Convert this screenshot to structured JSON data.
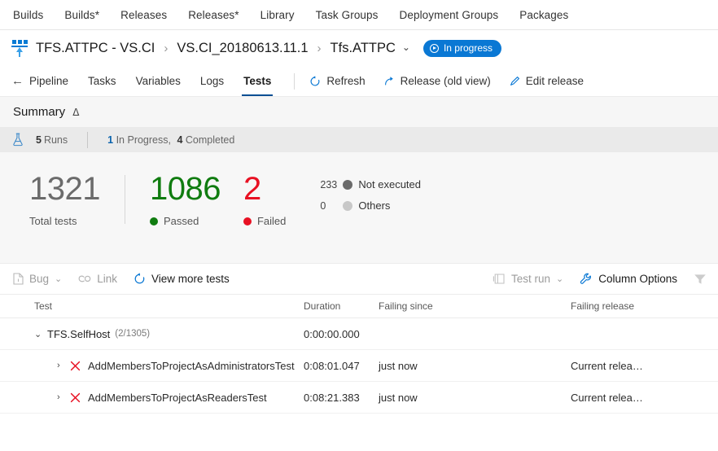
{
  "topnav": {
    "items": [
      {
        "label": "Builds"
      },
      {
        "label": "Builds*"
      },
      {
        "label": "Releases"
      },
      {
        "label": "Releases*"
      },
      {
        "label": "Library"
      },
      {
        "label": "Task Groups"
      },
      {
        "label": "Deployment Groups"
      },
      {
        "label": "Packages"
      }
    ]
  },
  "breadcrumb": {
    "release_icon": "release-pipeline-icon",
    "definition": "TFS.ATTPC - VS.CI",
    "separator": "›",
    "build": "VS.CI_20180613.11.1",
    "stage": "Tfs.ATTPC",
    "stage_chevron": "chevron-down-icon",
    "status_badge": "In progress",
    "status_color": "#0a78d4"
  },
  "pivotbar": {
    "back_arrow": "←",
    "back_label": "Pipeline",
    "tabs": [
      {
        "label": "Tasks",
        "active": false
      },
      {
        "label": "Variables",
        "active": false
      },
      {
        "label": "Logs",
        "active": false
      },
      {
        "label": "Tests",
        "active": true
      }
    ],
    "commands": [
      {
        "label": "Refresh",
        "icon": "refresh-icon"
      },
      {
        "label": "Release (old view)",
        "icon": "external-link-icon"
      },
      {
        "label": "Edit release",
        "icon": "pencil-icon"
      }
    ]
  },
  "summary": {
    "title": "Summary",
    "collapse_icon": "chevron-up-icon",
    "runs": {
      "icon": "flask-icon",
      "count": "5",
      "label": "Runs",
      "in_progress_count": "1",
      "in_progress_label": "In Progress,",
      "completed_count": "4",
      "completed_label": "Completed"
    },
    "stats": {
      "total": {
        "value": "1321",
        "label": "Total tests",
        "color": "#6b6b6b"
      },
      "passed": {
        "value": "1086",
        "label": "Passed",
        "color": "#107c10"
      },
      "failed": {
        "value": "2",
        "label": "Failed",
        "color": "#e81123"
      },
      "not_executed": {
        "value": "233",
        "label": "Not executed",
        "color": "#6b6b6b"
      },
      "others": {
        "value": "0",
        "label": "Others",
        "color": "#c8c8c8"
      }
    }
  },
  "results_toolbar": {
    "bug": {
      "label": "Bug",
      "icon": "bug-file-icon",
      "caret": "⌄"
    },
    "link": {
      "label": "Link",
      "icon": "link-icon"
    },
    "view_more": {
      "label": "View more tests",
      "icon": "refresh-icon"
    },
    "test_run": {
      "label": "Test run",
      "icon": "test-run-icon",
      "caret": "⌄"
    },
    "column_options": {
      "label": "Column Options",
      "icon": "wrench-icon"
    },
    "filter": {
      "icon": "filter-funnel-icon"
    }
  },
  "table": {
    "columns": [
      {
        "label": "Test"
      },
      {
        "label": "Duration"
      },
      {
        "label": "Failing since"
      },
      {
        "label": "Failing release"
      }
    ],
    "rows": [
      {
        "kind": "group",
        "chevron": "chevron-down-icon",
        "name": "TFS.SelfHost",
        "count": "(2/1305)",
        "duration": "0:00:00.000",
        "failing_since": "",
        "failing_release": ""
      },
      {
        "kind": "test",
        "chevron": "chevron-right-icon",
        "status_icon": "failed-x-icon",
        "name": "AddMembersToProjectAsAdministratorsTest",
        "duration": "0:08:01.047",
        "failing_since": "just now",
        "failing_release": "Current relea…"
      },
      {
        "kind": "test",
        "chevron": "chevron-right-icon",
        "status_icon": "failed-x-icon",
        "name": "AddMembersToProjectAsReadersTest",
        "duration": "0:08:21.383",
        "failing_since": "just now",
        "failing_release": "Current relea…"
      }
    ]
  }
}
